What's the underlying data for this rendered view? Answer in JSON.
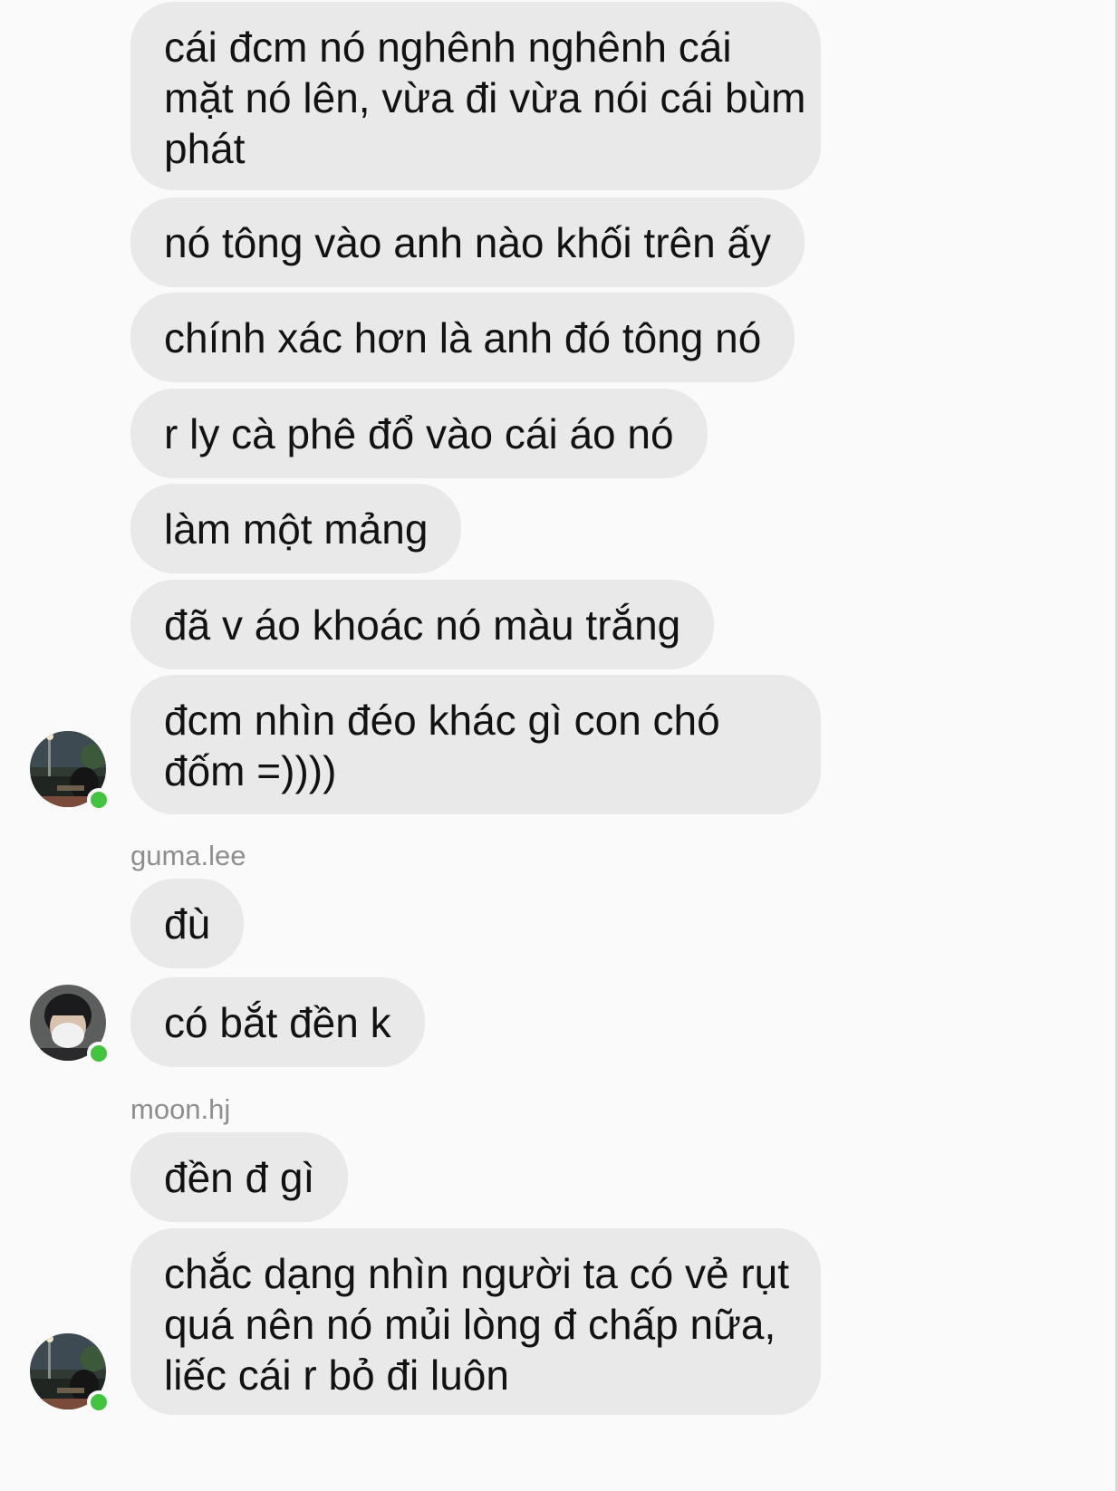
{
  "colors": {
    "background": "#fafafa",
    "bubble": "#e9e9e9",
    "text": "#121212",
    "sender": "#8e8e8e",
    "online": "#43c441"
  },
  "messages": [
    {
      "lines": [
        "cái đcm nó nghênh nghênh cái",
        "mặt nó lên, vừa đi vừa nói cái bùm",
        "phát"
      ]
    },
    {
      "lines": [
        "nó tông vào anh nào khối trên ấy"
      ]
    },
    {
      "lines": [
        "chính xác hơn là anh đó tông nó"
      ]
    },
    {
      "lines": [
        "r ly cà phê đổ vào cái áo nó"
      ]
    },
    {
      "lines": [
        "làm một mảng"
      ]
    },
    {
      "lines": [
        "đã v áo khoác nó màu trắng"
      ]
    },
    {
      "lines": [
        "đcm nhìn đéo khác gì con chó",
        "đốm =))))"
      ]
    },
    {
      "sender": "guma.lee"
    },
    {
      "lines": [
        "đù"
      ]
    },
    {
      "lines": [
        "có bắt đền k"
      ]
    },
    {
      "sender": "moon.hj"
    },
    {
      "lines": [
        "đền đ gì"
      ]
    },
    {
      "lines": [
        "chắc dạng nhìn người ta có vẻ rụt",
        "quá nên nó mủi lòng đ chấp nữa,",
        "liếc cái r bỏ đi luôn"
      ]
    }
  ],
  "avatars": [
    {
      "icon": "user-avatar-night-street-icon",
      "online": true
    },
    {
      "icon": "user-avatar-masked-person-icon",
      "online": true
    },
    {
      "icon": "user-avatar-night-street-icon",
      "online": true
    }
  ]
}
